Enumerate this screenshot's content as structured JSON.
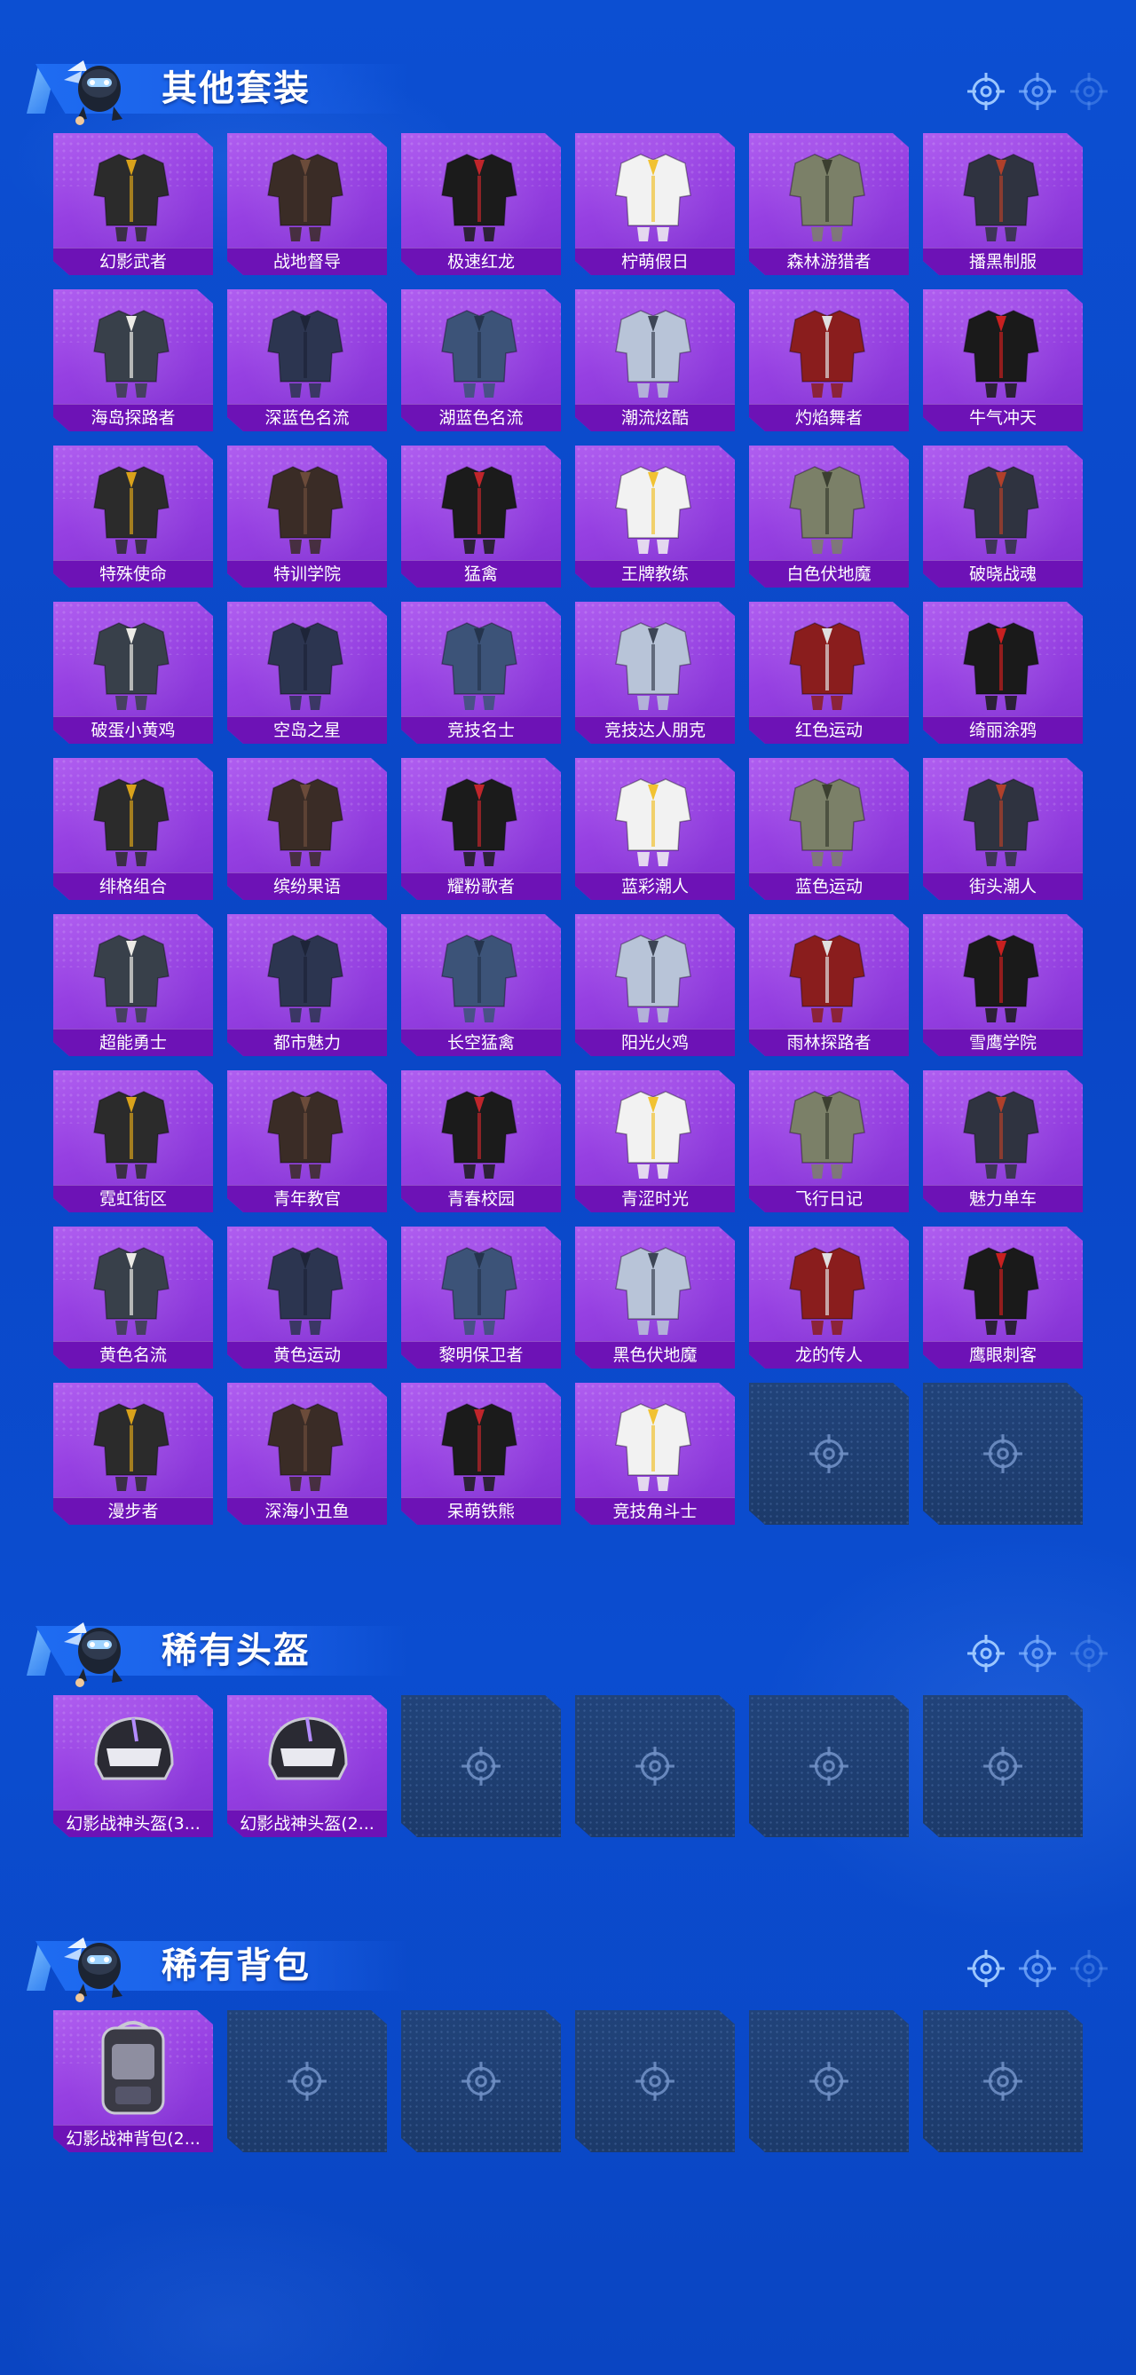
{
  "sections": [
    {
      "title": "其他套装",
      "items": [
        "幻影武者",
        "战地督导",
        "极速红龙",
        "柠萌假日",
        "森林游猎者",
        "播黑制服",
        "海岛探路者",
        "深蓝色名流",
        "湖蓝色名流",
        "潮流炫酷",
        "灼焰舞者",
        "牛气冲天",
        "特殊使命",
        "特训学院",
        "猛禽",
        "王牌教练",
        "白色伏地魔",
        "破晓战魂",
        "破蛋小黄鸡",
        "空岛之星",
        "竞技名士",
        "竞技达人朋克",
        "红色运动",
        "绮丽涂鸦",
        "绯格组合",
        "缤纷果语",
        "耀粉歌者",
        "蓝彩潮人",
        "蓝色运动",
        "街头潮人",
        "超能勇士",
        "都市魅力",
        "长空猛禽",
        "阳光火鸡",
        "雨林探路者",
        "雪鹰学院",
        "霓虹街区",
        "青年教官",
        "青春校园",
        "青涩时光",
        "飞行日记",
        "魅力单车",
        "黄色名流",
        "黄色运动",
        "黎明保卫者",
        "黑色伏地魔",
        "龙的传人",
        "鹰眼刺客",
        "漫步者",
        "深海小丑鱼",
        "呆萌铁熊",
        "竞技角斗士"
      ],
      "empty_slots": 2
    },
    {
      "title": "稀有头盔",
      "items": [
        "幻影战神头盔(3...",
        "幻影战神头盔(2..."
      ],
      "empty_slots": 4
    },
    {
      "title": "稀有背包",
      "items": [
        "幻影战神背包(2..."
      ],
      "empty_slots": 5
    }
  ],
  "colors": {
    "background": "#0b4bcd",
    "card_fill": "#9a45e4",
    "label_bar": "#6d12b6",
    "empty_card": "#1f3f72",
    "header_banner": "#1e6cf2"
  },
  "icons": {
    "header_decor": "crosshair-icon",
    "empty_slot": "crosshair-icon",
    "mascot": "mascot-icon"
  }
}
